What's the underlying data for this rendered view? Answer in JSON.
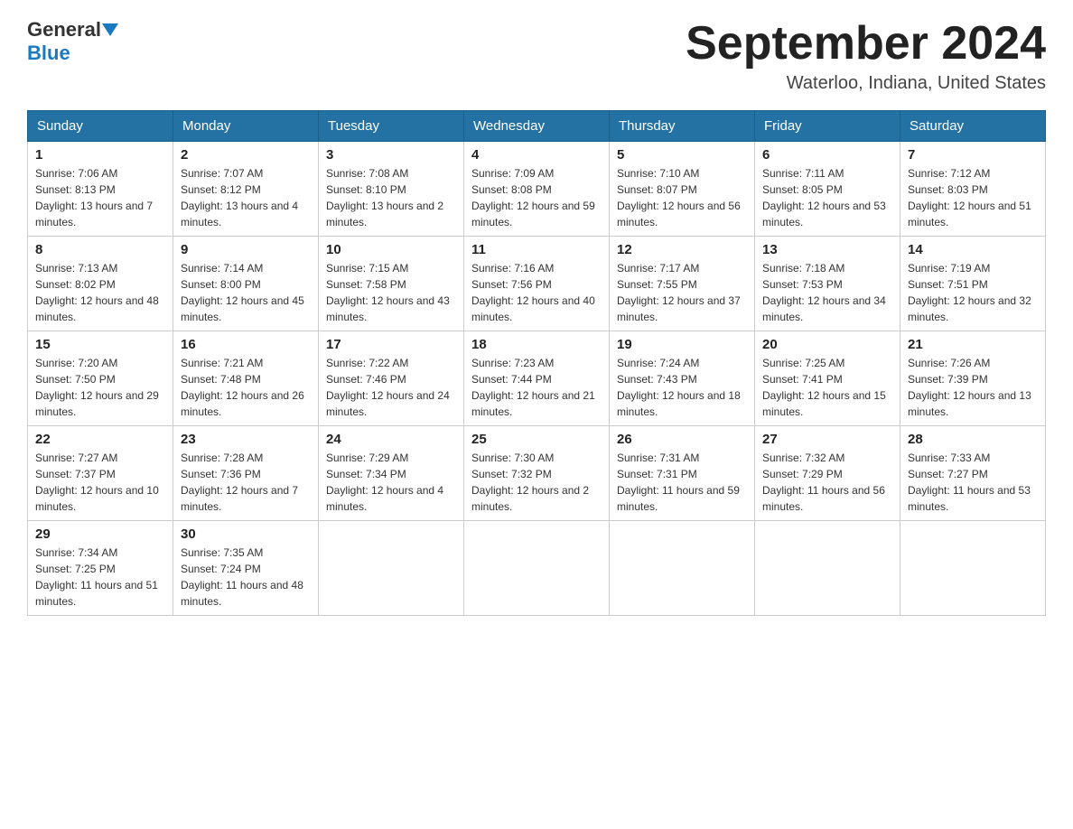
{
  "header": {
    "logo_general": "General",
    "logo_blue": "Blue",
    "month_title": "September 2024",
    "location": "Waterloo, Indiana, United States"
  },
  "weekdays": [
    "Sunday",
    "Monday",
    "Tuesday",
    "Wednesday",
    "Thursday",
    "Friday",
    "Saturday"
  ],
  "weeks": [
    [
      {
        "day": "1",
        "sunrise": "7:06 AM",
        "sunset": "8:13 PM",
        "daylight": "13 hours and 7 minutes."
      },
      {
        "day": "2",
        "sunrise": "7:07 AM",
        "sunset": "8:12 PM",
        "daylight": "13 hours and 4 minutes."
      },
      {
        "day": "3",
        "sunrise": "7:08 AM",
        "sunset": "8:10 PM",
        "daylight": "13 hours and 2 minutes."
      },
      {
        "day": "4",
        "sunrise": "7:09 AM",
        "sunset": "8:08 PM",
        "daylight": "12 hours and 59 minutes."
      },
      {
        "day": "5",
        "sunrise": "7:10 AM",
        "sunset": "8:07 PM",
        "daylight": "12 hours and 56 minutes."
      },
      {
        "day": "6",
        "sunrise": "7:11 AM",
        "sunset": "8:05 PM",
        "daylight": "12 hours and 53 minutes."
      },
      {
        "day": "7",
        "sunrise": "7:12 AM",
        "sunset": "8:03 PM",
        "daylight": "12 hours and 51 minutes."
      }
    ],
    [
      {
        "day": "8",
        "sunrise": "7:13 AM",
        "sunset": "8:02 PM",
        "daylight": "12 hours and 48 minutes."
      },
      {
        "day": "9",
        "sunrise": "7:14 AM",
        "sunset": "8:00 PM",
        "daylight": "12 hours and 45 minutes."
      },
      {
        "day": "10",
        "sunrise": "7:15 AM",
        "sunset": "7:58 PM",
        "daylight": "12 hours and 43 minutes."
      },
      {
        "day": "11",
        "sunrise": "7:16 AM",
        "sunset": "7:56 PM",
        "daylight": "12 hours and 40 minutes."
      },
      {
        "day": "12",
        "sunrise": "7:17 AM",
        "sunset": "7:55 PM",
        "daylight": "12 hours and 37 minutes."
      },
      {
        "day": "13",
        "sunrise": "7:18 AM",
        "sunset": "7:53 PM",
        "daylight": "12 hours and 34 minutes."
      },
      {
        "day": "14",
        "sunrise": "7:19 AM",
        "sunset": "7:51 PM",
        "daylight": "12 hours and 32 minutes."
      }
    ],
    [
      {
        "day": "15",
        "sunrise": "7:20 AM",
        "sunset": "7:50 PM",
        "daylight": "12 hours and 29 minutes."
      },
      {
        "day": "16",
        "sunrise": "7:21 AM",
        "sunset": "7:48 PM",
        "daylight": "12 hours and 26 minutes."
      },
      {
        "day": "17",
        "sunrise": "7:22 AM",
        "sunset": "7:46 PM",
        "daylight": "12 hours and 24 minutes."
      },
      {
        "day": "18",
        "sunrise": "7:23 AM",
        "sunset": "7:44 PM",
        "daylight": "12 hours and 21 minutes."
      },
      {
        "day": "19",
        "sunrise": "7:24 AM",
        "sunset": "7:43 PM",
        "daylight": "12 hours and 18 minutes."
      },
      {
        "day": "20",
        "sunrise": "7:25 AM",
        "sunset": "7:41 PM",
        "daylight": "12 hours and 15 minutes."
      },
      {
        "day": "21",
        "sunrise": "7:26 AM",
        "sunset": "7:39 PM",
        "daylight": "12 hours and 13 minutes."
      }
    ],
    [
      {
        "day": "22",
        "sunrise": "7:27 AM",
        "sunset": "7:37 PM",
        "daylight": "12 hours and 10 minutes."
      },
      {
        "day": "23",
        "sunrise": "7:28 AM",
        "sunset": "7:36 PM",
        "daylight": "12 hours and 7 minutes."
      },
      {
        "day": "24",
        "sunrise": "7:29 AM",
        "sunset": "7:34 PM",
        "daylight": "12 hours and 4 minutes."
      },
      {
        "day": "25",
        "sunrise": "7:30 AM",
        "sunset": "7:32 PM",
        "daylight": "12 hours and 2 minutes."
      },
      {
        "day": "26",
        "sunrise": "7:31 AM",
        "sunset": "7:31 PM",
        "daylight": "11 hours and 59 minutes."
      },
      {
        "day": "27",
        "sunrise": "7:32 AM",
        "sunset": "7:29 PM",
        "daylight": "11 hours and 56 minutes."
      },
      {
        "day": "28",
        "sunrise": "7:33 AM",
        "sunset": "7:27 PM",
        "daylight": "11 hours and 53 minutes."
      }
    ],
    [
      {
        "day": "29",
        "sunrise": "7:34 AM",
        "sunset": "7:25 PM",
        "daylight": "11 hours and 51 minutes."
      },
      {
        "day": "30",
        "sunrise": "7:35 AM",
        "sunset": "7:24 PM",
        "daylight": "11 hours and 48 minutes."
      },
      null,
      null,
      null,
      null,
      null
    ]
  ],
  "labels": {
    "sunrise": "Sunrise:",
    "sunset": "Sunset:",
    "daylight": "Daylight:"
  }
}
